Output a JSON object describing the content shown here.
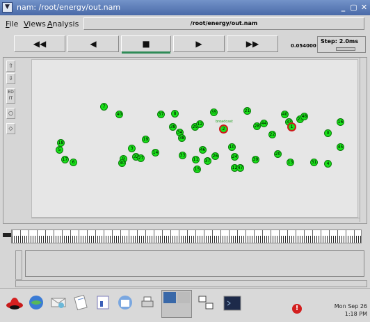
{
  "window": {
    "title": "nam: /root/energy/out.nam",
    "controls": [
      "_",
      "▢",
      "✕"
    ]
  },
  "menu": {
    "items": [
      "File",
      "Views",
      "Analysis"
    ],
    "file_path": "/root/energy/out.nam"
  },
  "playback": {
    "buttons": [
      "◀◀",
      "◀",
      "■",
      "▶",
      "▶▶"
    ],
    "time": "0.054000",
    "step_label": "Step: 2.0ms"
  },
  "left_toolbar": {
    "edit_label": "ED IT"
  },
  "nodes": [
    {
      "id": "7"
    },
    {
      "id": "40"
    },
    {
      "id": "37"
    },
    {
      "id": "8"
    },
    {
      "id": "35"
    },
    {
      "id": "21"
    },
    {
      "id": "40"
    },
    {
      "id": "23"
    },
    {
      "id": "48"
    },
    {
      "id": "33"
    },
    {
      "id": "38"
    },
    {
      "id": "34"
    },
    {
      "id": "38"
    },
    {
      "id": "29"
    },
    {
      "id": "12"
    },
    {
      "id": "28"
    },
    {
      "id": "44"
    },
    {
      "id": "22"
    },
    {
      "id": "18"
    },
    {
      "id": "19"
    },
    {
      "id": "5"
    },
    {
      "id": "17"
    },
    {
      "id": "6"
    },
    {
      "id": "3"
    },
    {
      "id": "9"
    },
    {
      "id": "30"
    },
    {
      "id": "32"
    },
    {
      "id": "27"
    },
    {
      "id": "14"
    },
    {
      "id": "33"
    },
    {
      "id": "46"
    },
    {
      "id": "11"
    },
    {
      "id": "37"
    },
    {
      "id": "26"
    },
    {
      "id": "10"
    },
    {
      "id": "24"
    },
    {
      "id": "15"
    },
    {
      "id": "12"
    },
    {
      "id": "47"
    },
    {
      "id": "39"
    },
    {
      "id": "20"
    },
    {
      "id": "13"
    },
    {
      "id": "31"
    },
    {
      "id": "4"
    },
    {
      "id": "0"
    },
    {
      "id": "45"
    },
    {
      "id": "16"
    },
    {
      "id": "2"
    },
    {
      "id": "1"
    }
  ],
  "node_label": "broadcast",
  "taskbar": {
    "clock_day": "Mon Sep 26",
    "clock_time": "1:18 PM",
    "alert_glyph": "!"
  }
}
